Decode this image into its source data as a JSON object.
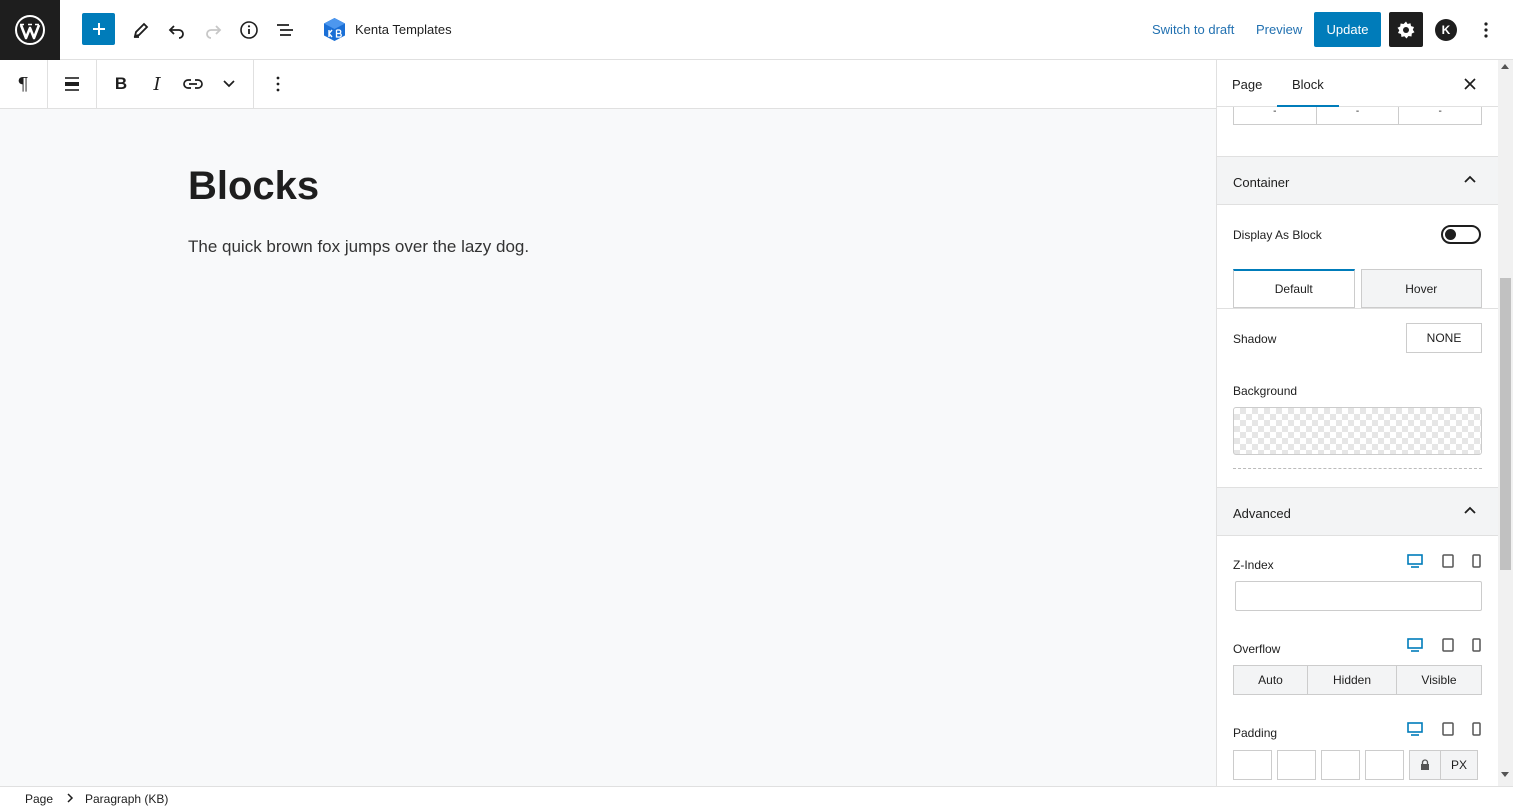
{
  "header": {
    "site_title": "Kenta Templates",
    "switch_to_draft": "Switch to draft",
    "preview": "Preview",
    "update": "Update",
    "avatar_letter": "K"
  },
  "block_toolbar": {
    "paragraph_icon": "pilcrow-icon",
    "align_icon": "align-icon",
    "bold": "B",
    "italic": "I",
    "link_icon": "link-icon",
    "more_icon": "chevron-down-icon",
    "options_icon": "more-vertical-icon"
  },
  "canvas": {
    "title": "Blocks",
    "paragraph": "The quick brown fox jumps over the lazy dog."
  },
  "sidebar": {
    "tabs": [
      {
        "label": "Page",
        "active": false
      },
      {
        "label": "Block",
        "active": true
      }
    ],
    "top_segment": [
      "-",
      "-",
      "-"
    ],
    "container": {
      "title": "Container",
      "display_as_block_label": "Display As Block",
      "display_as_block": false,
      "state_tabs": [
        {
          "label": "Default",
          "active": true
        },
        {
          "label": "Hover",
          "active": false
        }
      ],
      "shadow_label": "Shadow",
      "shadow_value": "NONE",
      "background_label": "Background"
    },
    "advanced": {
      "title": "Advanced",
      "z_index_label": "Z-Index",
      "z_index_value": "",
      "overflow_label": "Overflow",
      "overflow_options": [
        {
          "label": "Auto",
          "selected": false
        },
        {
          "label": "Hidden",
          "selected": false
        },
        {
          "label": "Visible",
          "selected": false
        }
      ],
      "padding_label": "Padding",
      "padding_values": [
        "",
        "",
        "",
        ""
      ],
      "padding_unit": "PX"
    }
  },
  "footer": {
    "breadcrumb": [
      "Page",
      "Paragraph (KB)"
    ]
  },
  "colors": {
    "accent": "#007cba",
    "link": "#2271b1",
    "dark": "#1e1e1e",
    "canvas_bg": "#f8f9fa"
  }
}
